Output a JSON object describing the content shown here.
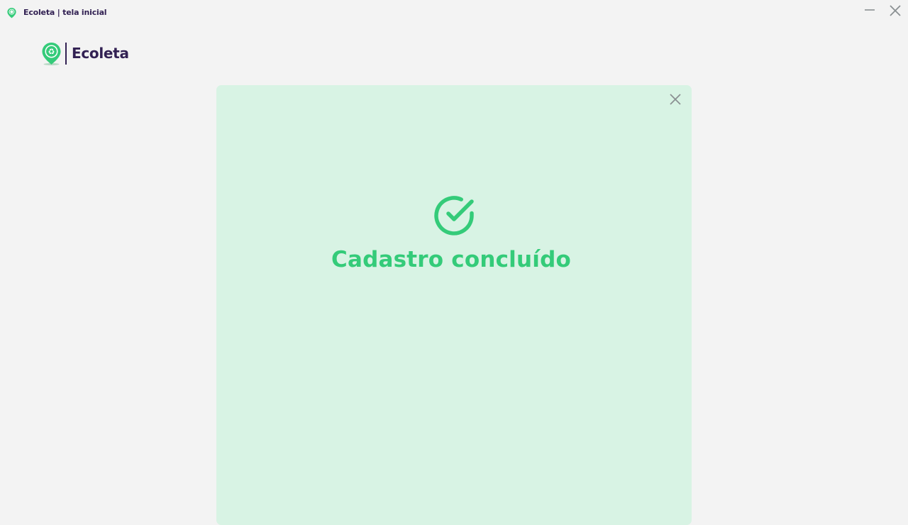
{
  "window": {
    "title": "Ecoleta | tela inicial",
    "icon": "map-pin-recycle-icon",
    "controls": [
      "minimize-icon",
      "close-icon"
    ]
  },
  "brand": {
    "name": "Ecoleta",
    "logo_icon": "map-pin-recycle-icon"
  },
  "modal": {
    "status_icon": "check-circle-icon",
    "message": "Cadastro concluído",
    "close_icon": "close-icon"
  },
  "colors": {
    "background": "#f3f3f3",
    "brand_dark": "#322153",
    "accent_green": "#34cb79",
    "modal_bg": "#d8f3e4",
    "muted_icon": "#8a8f92"
  }
}
